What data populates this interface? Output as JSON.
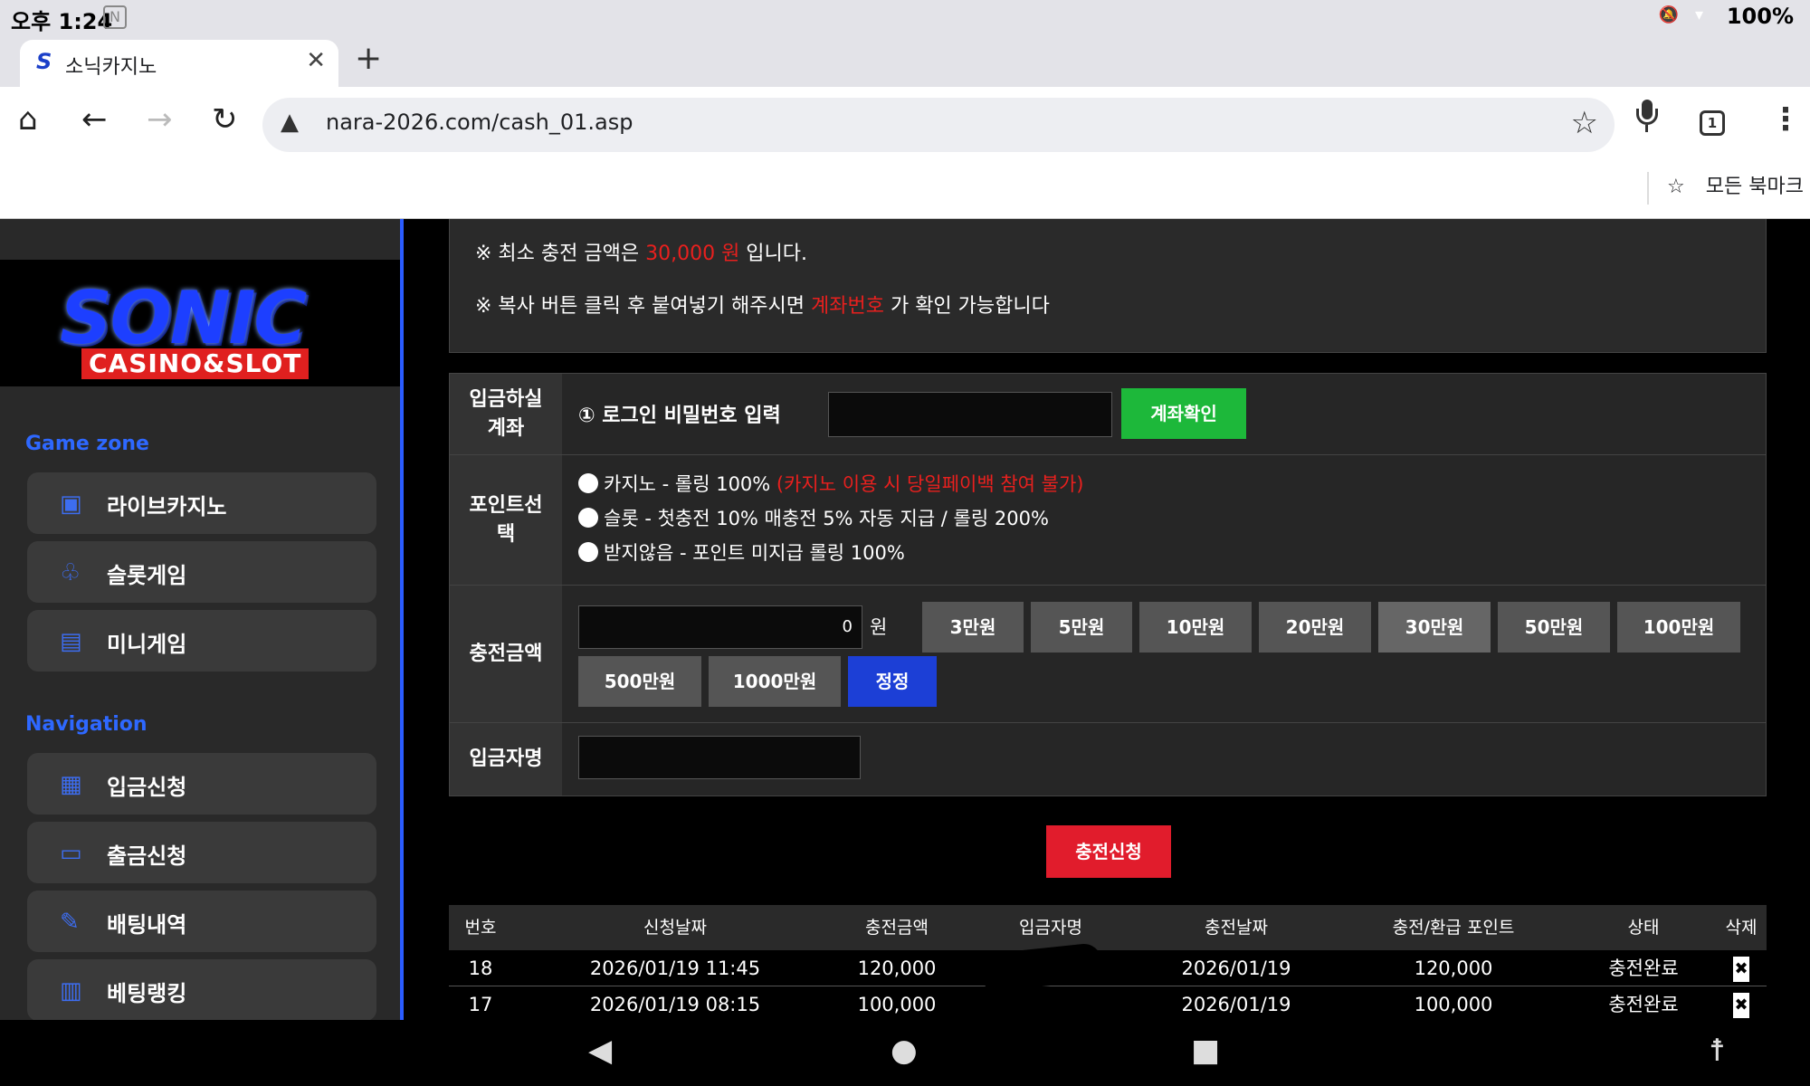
{
  "status_bar": {
    "time": "오후 1:24",
    "battery": "100%"
  },
  "browser": {
    "tab_title": "소닉카지노",
    "url": "nara-2026.com/cash_01.asp",
    "tab_count": "1",
    "all_bookmarks": "모든 북마크"
  },
  "sidebar": {
    "logo_main": "SONIC",
    "logo_sub": "CASINO&SLOT",
    "game_zone_title": "Game zone",
    "game_items": [
      {
        "label": "라이브카지노",
        "icon": "live-casino-icon"
      },
      {
        "label": "슬롯게임",
        "icon": "slot-icon"
      },
      {
        "label": "미니게임",
        "icon": "mini-game-icon"
      }
    ],
    "navigation_title": "Navigation",
    "nav_items": [
      {
        "label": "입금신청",
        "icon": "deposit-icon"
      },
      {
        "label": "출금신청",
        "icon": "withdraw-icon"
      },
      {
        "label": "배팅내역",
        "icon": "bet-history-icon"
      },
      {
        "label": "베팅랭킹",
        "icon": "ranking-icon"
      }
    ],
    "accent_color": "#2a5cff"
  },
  "notice": {
    "line1_prefix": "※ 최소 충전 금액은 ",
    "line1_amount": "30,000 원",
    "line1_suffix": " 입니다.",
    "line2_prefix": "※ 복사 버튼 클릭 후 붙여넣기 해주시면 ",
    "line2_highlight": "계좌번호",
    "line2_suffix": " 가 확인 가능합니다"
  },
  "form": {
    "account_label_1": "입금하실",
    "account_label_2": "계좌",
    "password_label": "① 로그인 비밀번호 입력",
    "account_check_button": "계좌확인",
    "point_label_1": "포인트선",
    "point_label_2": "택",
    "point_options": [
      {
        "text": "카지노 - 롤링 100% ",
        "note": "(카지노 이용 시 당일페이백 참여 불가)"
      },
      {
        "text": "슬롯 - 첫충전 10% 매충전 5% 자동 지급 / 롤링 200%",
        "note": ""
      },
      {
        "text": "받지않음 - 포인트 미지급 롤링 100%",
        "note": ""
      }
    ],
    "amount_label": "충전금액",
    "amount_value": "0",
    "amount_unit": "원",
    "amount_buttons": [
      "3만원",
      "5만원",
      "10만원",
      "20만원",
      "30만원",
      "50만원",
      "100만원",
      "500만원",
      "1000만원"
    ],
    "reset_button": "정정",
    "depositor_label": "입금자명"
  },
  "submit_button": "충전신청",
  "history": {
    "headers": [
      "번호",
      "신청날짜",
      "충전금액",
      "입금자명",
      "충전날짜",
      "충전/환급 포인트",
      "상태",
      "삭제"
    ],
    "rows": [
      {
        "no": "18",
        "req_date": "2026/01/19 11:45",
        "amount": "120,000",
        "name": "",
        "charge_date": "2026/01/19",
        "points": "120,000",
        "status": "충전완료",
        "del": "✖"
      },
      {
        "no": "17",
        "req_date": "2026/01/19 08:15",
        "amount": "100,000",
        "name": "",
        "charge_date": "2026/01/19",
        "points": "100,000",
        "status": "충전완료",
        "del": "✖"
      }
    ]
  },
  "colors": {
    "red": "#e8201e",
    "green": "#1db83a",
    "blue": "#1c3fd6",
    "submit": "#e11c2c"
  }
}
